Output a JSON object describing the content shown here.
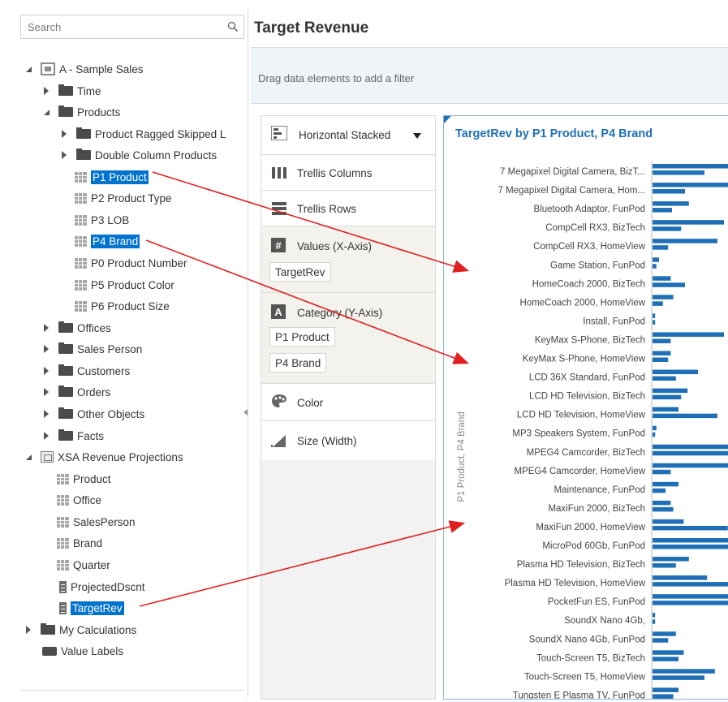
{
  "search": {
    "placeholder": "Search"
  },
  "tree": {
    "subject_area": "A - Sample Sales",
    "time": "Time",
    "products": "Products",
    "product_ragged": "Product Ragged Skipped L",
    "double_column": "Double Column Products",
    "p1_product": "P1 Product",
    "p2_product_type": "P2 Product Type",
    "p3_lob": "P3 LOB",
    "p4_brand": "P4 Brand",
    "p0_product_number": "P0 Product Number",
    "p5_product_color": "P5 Product Color",
    "p6_product_size": "P6 Product Size",
    "offices": "Offices",
    "sales_person": "Sales Person",
    "customers": "Customers",
    "orders": "Orders",
    "other_objects": "Other Objects",
    "facts": "Facts",
    "xsa": "XSA Revenue Projections",
    "xsa_product": "Product",
    "xsa_office": "Office",
    "xsa_salesperson": "SalesPerson",
    "xsa_brand": "Brand",
    "xsa_quarter": "Quarter",
    "xsa_projected": "ProjectedDscnt",
    "xsa_targetrev": "TargetRev",
    "my_calculations": "My Calculations",
    "value_labels": "Value Labels"
  },
  "canvas": {
    "title": "Target Revenue",
    "filter_hint": "Drag data elements to add a filter"
  },
  "grammar": {
    "chart_type": "Horizontal Stacked",
    "trellis_columns": "Trellis Columns",
    "trellis_rows": "Trellis Rows",
    "values_label": "Values (X-Axis)",
    "values_item": "TargetRev",
    "category_label": "Category (Y-Axis)",
    "category_item_1": "P1 Product",
    "category_item_2": "P4 Brand",
    "color": "Color",
    "size": "Size (Width)"
  },
  "chart_data": {
    "type": "bar",
    "title": "TargetRev by P1 Product, P4 Brand",
    "ylabel": "P1 Product, P4 Brand",
    "xlabel": "",
    "bar_color": "#1f6fb6",
    "categories": [
      "7 Megapixel Digital Camera, BizT...",
      "7 Megapixel Digital Camera, Hom...",
      "Bluetooth Adaptor, FunPod",
      "CompCell RX3, BizTech",
      "CompCell RX3, HomeView",
      "Game Station, FunPod",
      "HomeCoach 2000, BizTech",
      "HomeCoach 2000, HomeView",
      "Install, FunPod",
      "KeyMax S-Phone, BizTech",
      "KeyMax S-Phone, HomeView",
      "LCD 36X Standard, FunPod",
      "LCD HD Television, BizTech",
      "LCD HD Television, HomeView",
      "MP3 Speakers System, FunPod",
      "MPEG4 Camcorder, BizTech",
      "MPEG4 Camcorder, HomeView",
      "Maintenance, FunPod",
      "MaxiFun 2000, BizTech",
      "MaxiFun 2000, HomeView",
      "MicroPod 60Gb, FunPod",
      "Plasma HD Television, BizTech",
      "Plasma HD Television, HomeView",
      "PocketFun ES, FunPod",
      "SoundX Nano 4Gb,",
      "SoundX Nano 4Gb, FunPod",
      "Touch-Screen T5, BizTech",
      "Touch-Screen T5, HomeView",
      "Tungsten E Plasma TV, FunPod"
    ],
    "segments": [
      [
        100,
        40
      ],
      [
        100,
        25
      ],
      [
        28,
        15
      ],
      [
        55,
        22
      ],
      [
        50,
        12
      ],
      [
        5,
        3
      ],
      [
        14,
        25
      ],
      [
        16,
        8
      ],
      [
        2,
        2
      ],
      [
        55,
        14
      ],
      [
        14,
        12
      ],
      [
        35,
        18
      ],
      [
        27,
        22
      ],
      [
        20,
        50
      ],
      [
        3,
        2
      ],
      [
        100,
        100
      ],
      [
        100,
        14
      ],
      [
        20,
        10
      ],
      [
        14,
        16
      ],
      [
        24,
        58
      ],
      [
        62,
        80
      ],
      [
        28,
        18
      ],
      [
        42,
        70
      ],
      [
        100,
        70
      ],
      [
        2,
        2
      ],
      [
        18,
        12
      ],
      [
        24,
        20
      ],
      [
        48,
        40
      ],
      [
        20,
        16
      ]
    ]
  },
  "arrows_color": "#e02020"
}
